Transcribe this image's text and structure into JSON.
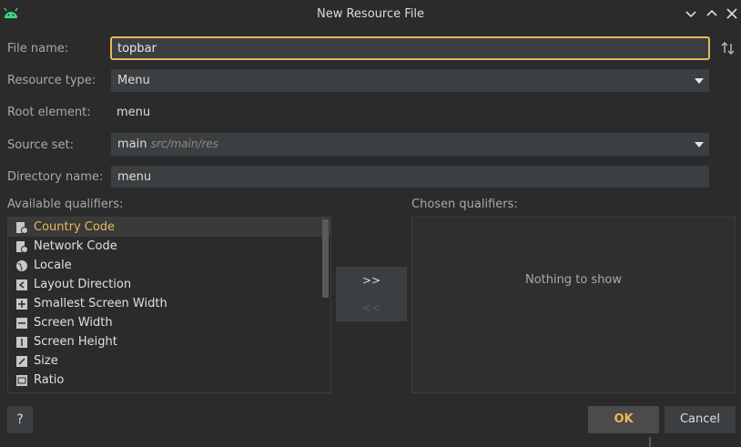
{
  "window": {
    "title": "New Resource File",
    "app_icon": "android-icon"
  },
  "form": {
    "file_name_label": "File name:",
    "file_name_value": "topbar",
    "resource_type_label": "Resource type:",
    "resource_type_value": "Menu",
    "root_element_label": "Root element:",
    "root_element_value": "menu",
    "source_set_label": "Source set:",
    "source_set_value": "main",
    "source_set_path": "src/main/res",
    "directory_name_label": "Directory name:",
    "directory_name_value": "menu"
  },
  "qualifiers": {
    "available_label": "Available qualifiers:",
    "chosen_label": "Chosen qualifiers:",
    "items": [
      {
        "label": "Country Code",
        "icon": "country-code-icon"
      },
      {
        "label": "Network Code",
        "icon": "network-code-icon"
      },
      {
        "label": "Locale",
        "icon": "globe-icon"
      },
      {
        "label": "Layout Direction",
        "icon": "layout-direction-icon"
      },
      {
        "label": "Smallest Screen Width",
        "icon": "smallest-width-icon"
      },
      {
        "label": "Screen Width",
        "icon": "screen-width-icon"
      },
      {
        "label": "Screen Height",
        "icon": "screen-height-icon"
      },
      {
        "label": "Size",
        "icon": "size-icon"
      },
      {
        "label": "Ratio",
        "icon": "ratio-icon"
      }
    ],
    "add_button": ">>",
    "remove_button": "<<",
    "chosen_empty": "Nothing to show"
  },
  "buttons": {
    "help": "?",
    "ok": "OK",
    "cancel": "Cancel"
  },
  "colors": {
    "accent": "#e8b85a",
    "background": "#2b2b2b",
    "field": "#3c3f41",
    "android_green": "#3ddc84"
  }
}
